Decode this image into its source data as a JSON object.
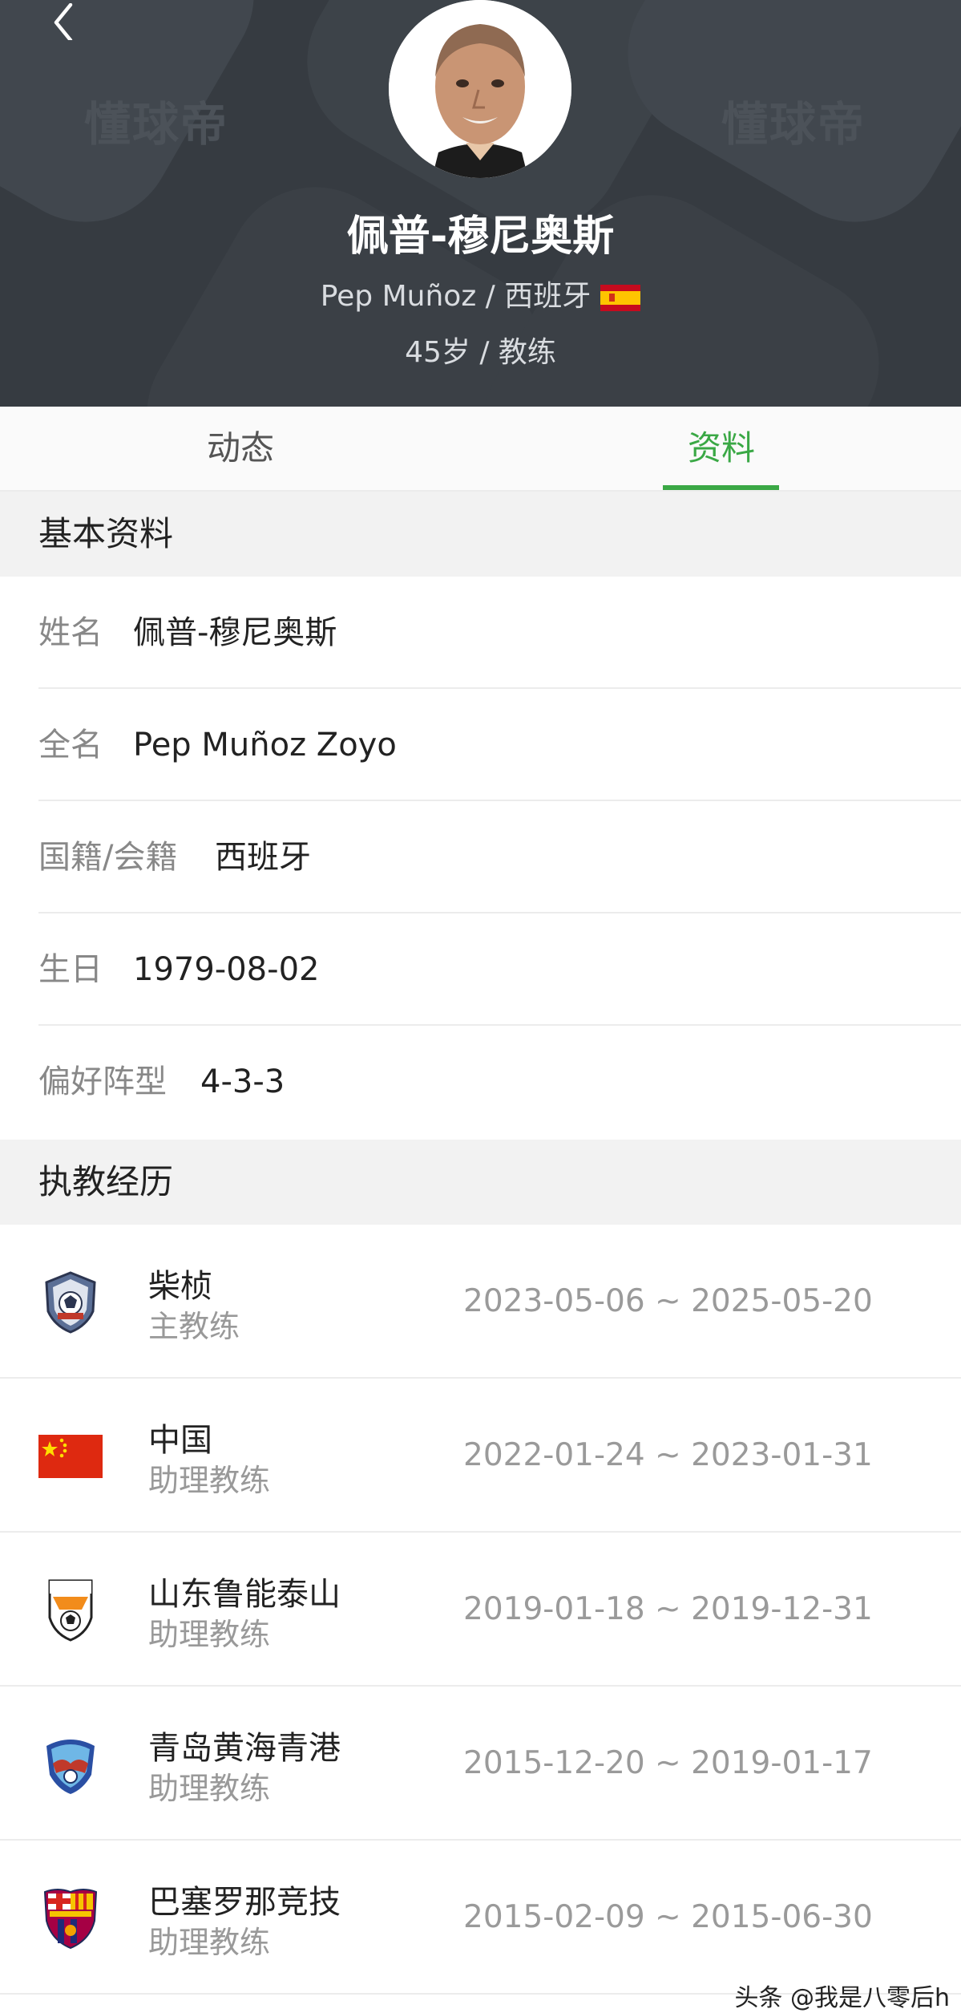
{
  "header": {
    "watermark": "懂球帝",
    "name": "佩普-穆尼奥斯",
    "name_en": "Pep Muñoz",
    "separator": " / ",
    "nationality": "西班牙",
    "age": "45岁",
    "role": "教练",
    "back_icon": "chevron-left-icon",
    "flag_icon": "spain-flag-icon",
    "bg_color": "#363b41"
  },
  "tabs": [
    {
      "label": "动态",
      "active": false
    },
    {
      "label": "资料",
      "active": true
    }
  ],
  "accent_color": "#3aa845",
  "basic": {
    "title": "基本资料",
    "rows": [
      {
        "label": "姓名",
        "value": "佩普-穆尼奥斯"
      },
      {
        "label": "全名",
        "value": "Pep Muñoz Zoyo"
      },
      {
        "label": "国籍/会籍",
        "value": "西班牙"
      },
      {
        "label": "生日",
        "value": "1979-08-02"
      },
      {
        "label": "偏好阵型",
        "value": "4-3-3"
      }
    ]
  },
  "history": {
    "title": "执教经历",
    "rows": [
      {
        "team": "柴桢",
        "role": "主教练",
        "dates": "2023-05-06 ~ 2025-05-20",
        "logo": "chaizhen-badge-icon"
      },
      {
        "team": "中国",
        "role": "助理教练",
        "dates": "2022-01-24 ~ 2023-01-31",
        "logo": "china-flag-icon"
      },
      {
        "team": "山东鲁能泰山",
        "role": "助理教练",
        "dates": "2019-01-18 ~ 2019-12-31",
        "logo": "shandong-luneng-badge-icon"
      },
      {
        "team": "青岛黄海青港",
        "role": "助理教练",
        "dates": "2015-12-20 ~ 2019-01-17",
        "logo": "qingdao-huanghai-badge-icon"
      },
      {
        "team": "巴塞罗那竞技",
        "role": "助理教练",
        "dates": "2015-02-09 ~ 2015-06-30",
        "logo": "barcelona-atletic-badge-icon"
      }
    ]
  },
  "footer_watermark": "头条 @我是八零后h"
}
